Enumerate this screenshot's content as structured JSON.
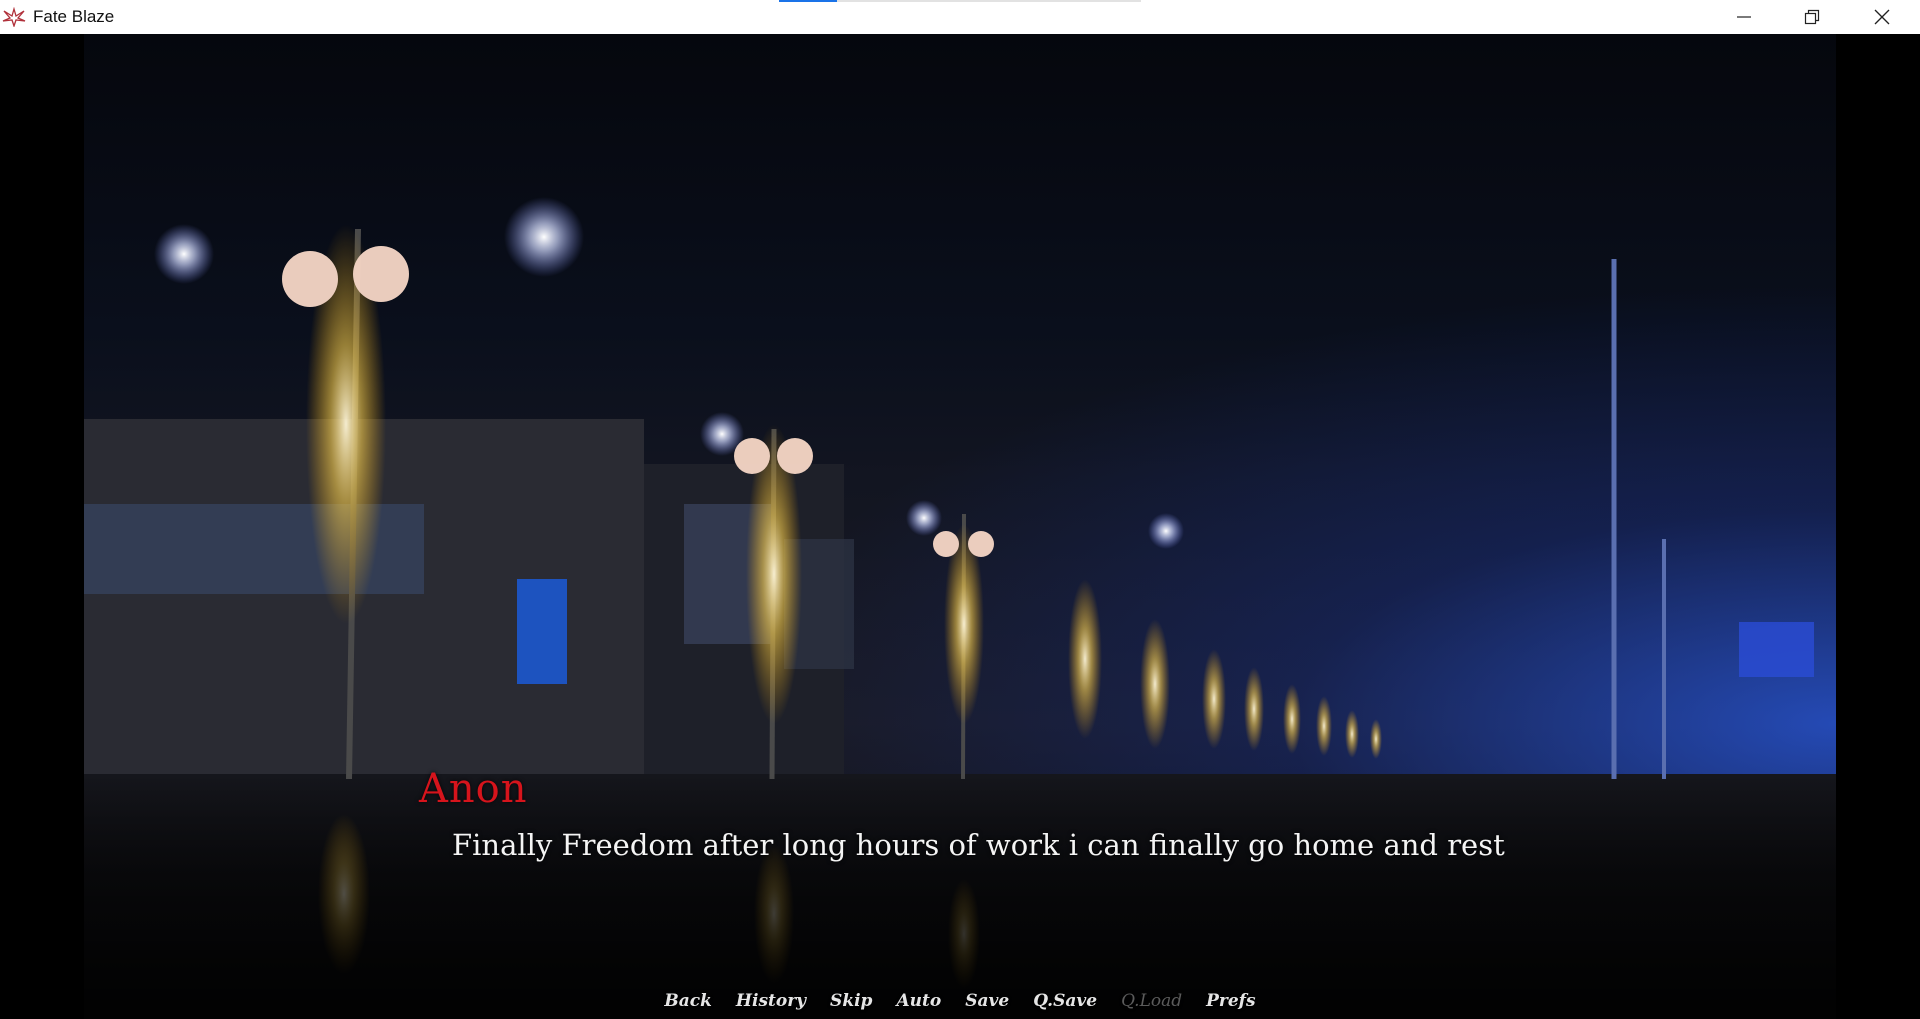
{
  "window": {
    "title": "Fate Blaze",
    "loading_progress": 0.16
  },
  "dialogue": {
    "speaker": "Anon",
    "speaker_color": "#d6141c",
    "text": "Finally Freedom after long hours of work i can finally go home and rest"
  },
  "quick_menu": {
    "items": [
      {
        "label": "Back",
        "enabled": true
      },
      {
        "label": "History",
        "enabled": true
      },
      {
        "label": "Skip",
        "enabled": true
      },
      {
        "label": "Auto",
        "enabled": true
      },
      {
        "label": "Save",
        "enabled": true
      },
      {
        "label": "Q.Save",
        "enabled": true
      },
      {
        "label": "Q.Load",
        "enabled": false
      },
      {
        "label": "Prefs",
        "enabled": true
      }
    ]
  },
  "scene": {
    "description_icon": "night-street-lights-background",
    "accent_colors": {
      "lamp_glow": "#ffd24a",
      "sky": "#05070d",
      "blue_glow": "#2a5ae6"
    }
  }
}
